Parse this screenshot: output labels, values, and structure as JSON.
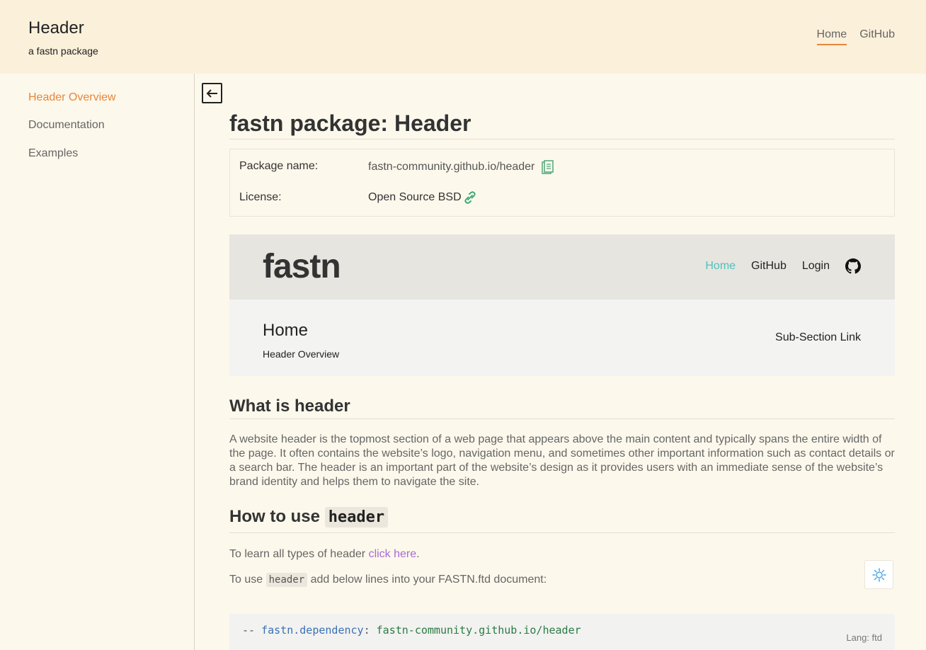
{
  "header": {
    "title": "Header",
    "subtitle": "a fastn package",
    "nav": [
      "Home",
      "GitHub"
    ]
  },
  "sidebar": {
    "items": [
      {
        "label": "Header Overview",
        "active": true
      },
      {
        "label": "Documentation",
        "active": false
      },
      {
        "label": "Examples",
        "active": false
      }
    ]
  },
  "main": {
    "title": "fastn package: Header",
    "info": {
      "package_label": "Package name:",
      "package_value": "fastn-community.github.io/header",
      "license_label": "License:",
      "license_value": "Open Source BSD"
    },
    "preview": {
      "logo": "fastn",
      "nav": [
        "Home",
        "GitHub",
        "Login"
      ],
      "section_title": "Home",
      "section_subtitle": "Header Overview",
      "subsection_link": "Sub-Section Link"
    },
    "what_heading": "What is header",
    "what_text": "A website header is the topmost section of a web page that appears above the main content and typically spans the entire width of the page. It often contains the website’s logo, navigation menu, and sometimes other important information such as contact details or a search bar. The header is an important part of the website’s design as it provides users with an immediate sense of the website’s brand identity and helps them to navigate the site.",
    "howto_heading": "How to use",
    "howto_code": "header",
    "learn_text": "To learn all types of header ",
    "learn_link": "click here",
    "learn_suffix": ".",
    "use_prefix": "To use",
    "use_code": "header",
    "use_suffix": "add below lines into your FASTN.ftd document:",
    "code": {
      "dash": "--",
      "kw": "fastn.dependency",
      "colon": ":",
      "value": "fastn-community.github.io/header",
      "lang": "Lang: ftd"
    }
  },
  "colors": {
    "accent": "#e8863b",
    "link": "#a66bd3",
    "preview_home": "#4fc1c0"
  },
  "icons": [
    "back-arrow-icon",
    "copy-icon",
    "link-icon",
    "github-icon",
    "sun-icon"
  ]
}
